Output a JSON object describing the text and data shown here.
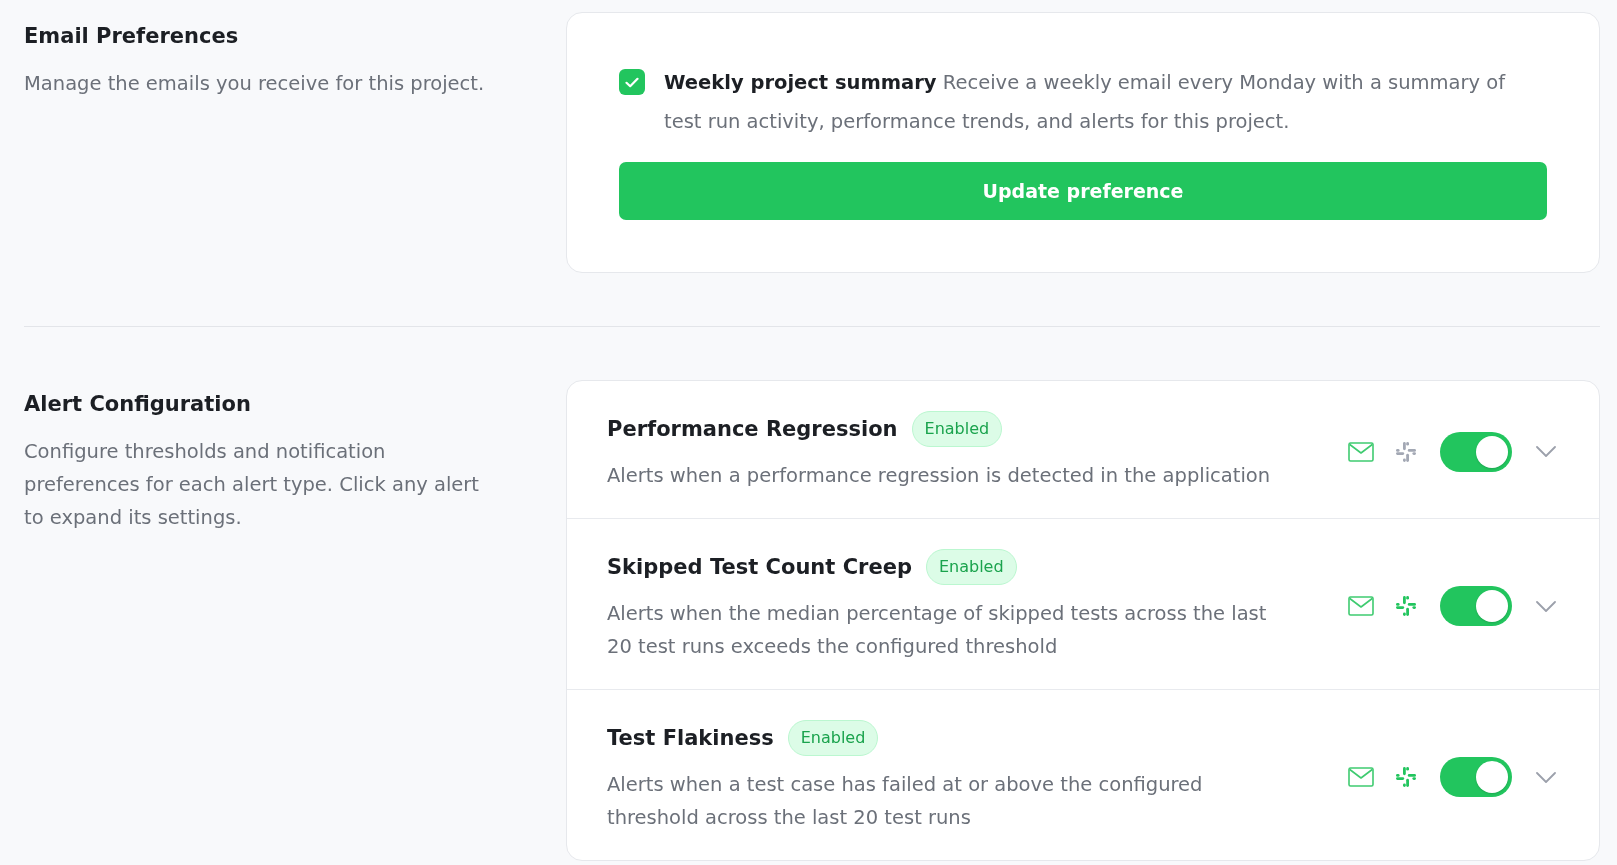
{
  "sections": [
    {
      "kind": "email",
      "title": "Email Preferences",
      "description": "Manage the emails you receive for this project.",
      "preference": {
        "checked": true,
        "text": "**Weekly project summary** Receive a weekly email every Monday with a summary of test run activity, performance trends, and alerts for this project."
      },
      "button": "Update preference"
    },
    {
      "kind": "alerts",
      "title": "Alert Configuration",
      "description": "Configure thresholds and notification preferences for each alert type. Click any alert to expand its settings.",
      "alerts": [
        {
          "name": "Performance Regression",
          "badge": "Enabled",
          "description": "Alerts when a performance regression is detected in the application",
          "email": true,
          "slack": false,
          "on": true,
          "expanded": false
        },
        {
          "name": "Skipped Test Count Creep",
          "badge": "Enabled",
          "description": "Alerts when the median percentage of skipped tests across the last 20 test runs exceeds the configured threshold",
          "email": true,
          "slack": true,
          "on": true,
          "expanded": false
        },
        {
          "name": "Test Flakiness",
          "badge": "Enabled",
          "description": "Alerts when a test case has failed at or above the configured threshold across the last 20 test runs",
          "email": true,
          "slack": true,
          "on": true,
          "expanded": false
        }
      ]
    }
  ]
}
